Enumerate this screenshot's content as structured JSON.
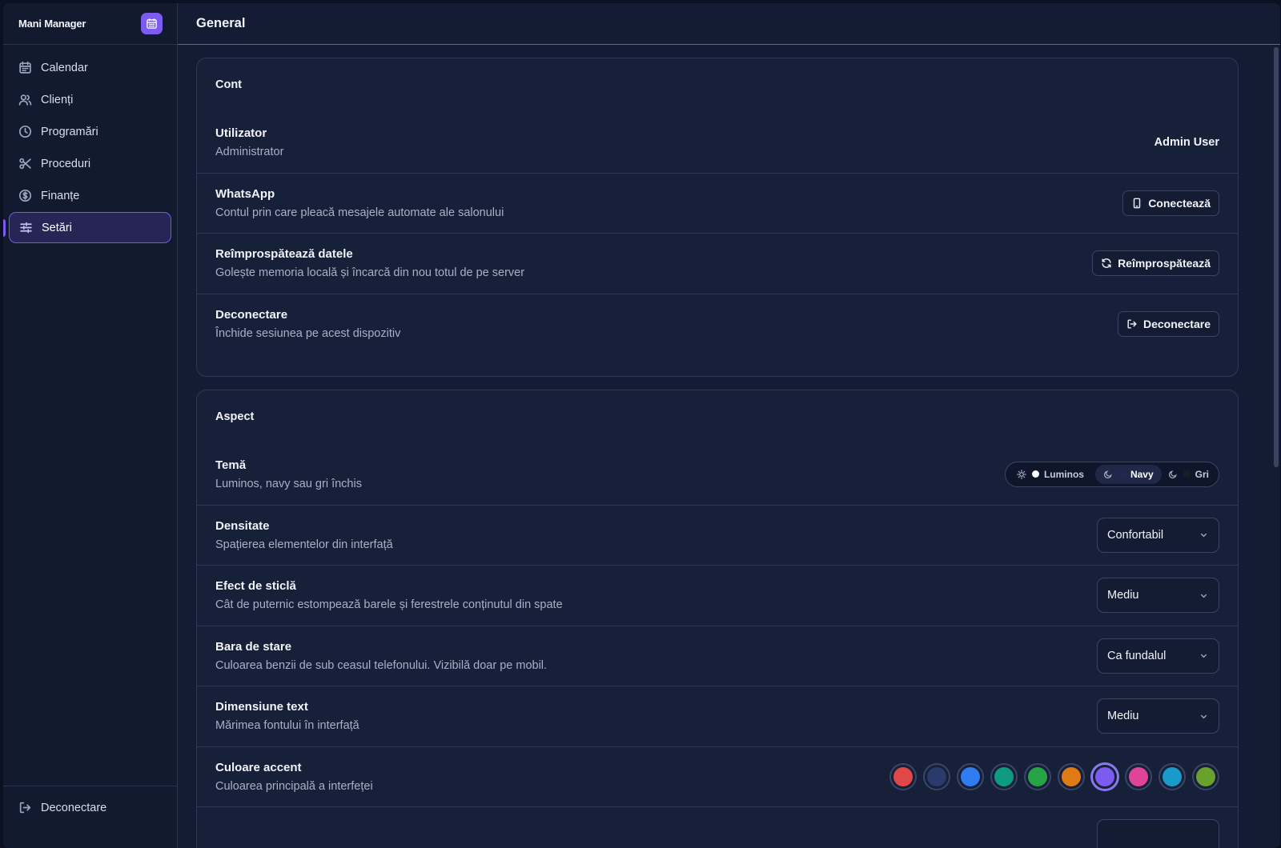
{
  "app": {
    "name": "Mani Manager"
  },
  "sidebar": {
    "items": [
      {
        "label": "Calendar",
        "icon": "calendar-icon"
      },
      {
        "label": "Clienți",
        "icon": "users-icon"
      },
      {
        "label": "Programări",
        "icon": "clock-icon"
      },
      {
        "label": "Proceduri",
        "icon": "scissors-icon"
      },
      {
        "label": "Finanțe",
        "icon": "dollar-icon"
      },
      {
        "label": "Setări",
        "icon": "sliders-icon",
        "active": true
      }
    ],
    "logout_label": "Deconectare"
  },
  "header": {
    "title": "General"
  },
  "account": {
    "title": "Cont",
    "user": {
      "label": "Utilizator",
      "desc": "Administrator",
      "value": "Admin User"
    },
    "whatsapp": {
      "label": "WhatsApp",
      "desc": "Contul prin care pleacă mesajele automate ale salonului",
      "button": "Conectează"
    },
    "refresh": {
      "label": "Reîmprospătează datele",
      "desc": "Golește memoria locală și încarcă din nou totul de pe server",
      "button": "Reîmprospătează"
    },
    "logout": {
      "label": "Deconectare",
      "desc": "Închide sesiunea pe acest dispozitiv",
      "button": "Deconectare"
    }
  },
  "appearance": {
    "title": "Aspect",
    "theme": {
      "label": "Temă",
      "desc": "Luminos, navy sau gri închis",
      "options": [
        {
          "label": "Luminos",
          "icon": "sun-icon",
          "dot_color": "#ffffff"
        },
        {
          "label": "Navy",
          "icon": "moon-icon",
          "dot_color": "#1e2a55",
          "active": true
        },
        {
          "label": "Gri",
          "icon": "moon-icon",
          "dot_color": "#1a1d24"
        }
      ]
    },
    "density": {
      "label": "Densitate",
      "desc": "Spațierea elementelor din interfață",
      "value": "Confortabil"
    },
    "glass": {
      "label": "Efect de sticlă",
      "desc": "Cât de puternic estompează barele și ferestrele conținutul din spate",
      "value": "Mediu"
    },
    "status_bar": {
      "label": "Bara de stare",
      "desc": "Culoarea benzii de sub ceasul telefonului. Vizibilă doar pe mobil.",
      "value": "Ca fundalul"
    },
    "text_size": {
      "label": "Dimensiune text",
      "desc": "Mărimea fontului în interfață",
      "value": "Mediu"
    },
    "accent": {
      "label": "Culoare accent",
      "desc": "Culoarea principală a interfeței",
      "colors": [
        "#e04848",
        "#2a3a6a",
        "#2f7bf0",
        "#0f9a82",
        "#27a348",
        "#e07a14",
        "#7c5cf0",
        "#e0449a",
        "#1a9ac8",
        "#6aa02c"
      ],
      "selected_index": 6
    }
  },
  "colors": {
    "accent": "#7c5cf0",
    "background": "#141c33",
    "card": "#172039"
  }
}
